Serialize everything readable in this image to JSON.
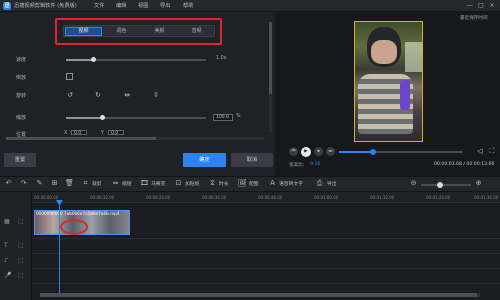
{
  "app": {
    "logo_glyph": "迅",
    "title": "迅捷视频剪辑软件 (免费版)",
    "menu": [
      "文件",
      "编辑",
      "视图",
      "导出",
      "帮助"
    ],
    "window_controls": [
      "—",
      "□",
      "×"
    ]
  },
  "editor": {
    "tabs": [
      {
        "label": "视频",
        "active": true
      },
      {
        "label": "调色",
        "active": false
      },
      {
        "label": "美颜",
        "active": false
      },
      {
        "label": "音频",
        "active": false
      }
    ],
    "speed": {
      "label": "速度",
      "value": "1.0x",
      "level": 0.1
    },
    "reverse": {
      "label": "倒放",
      "checked": false
    },
    "rotate": {
      "label": "旋转",
      "icons": [
        "rotate-ccw-icon",
        "rotate-cw-icon",
        "flip-horizontal-icon",
        "flip-vertical-icon"
      ],
      "glyphs": [
        "↺",
        "↻",
        "⇹",
        "⇳"
      ]
    },
    "scale": {
      "label": "缩放",
      "value": "100.0",
      "unit": "%",
      "level": 0.25
    },
    "position": {
      "label": "位置",
      "x_label": "X",
      "x_value": "0.0",
      "y_label": "Y",
      "y_value": "0.0"
    },
    "buttons": {
      "reset": "重置",
      "ok": "确定",
      "cancel": "取消"
    }
  },
  "preview": {
    "label": "最近保存时间",
    "controls": [
      "⏮",
      "▶",
      "⏹",
      "⏭"
    ],
    "progress": 0.26,
    "ratio_label": "宽高比:",
    "ratio_value": "9:16",
    "timecode": "00:00:03.68 / 00:00:13.66",
    "right_icons": [
      "◁",
      "⛶"
    ]
  },
  "toolbar": {
    "icons": [
      "↶",
      "↷",
      "✎",
      "⊞",
      "🗑"
    ],
    "items": [
      {
        "icon": "⌗",
        "label": "裁剪"
      },
      {
        "icon": "⇔",
        "label": "缩短"
      },
      {
        "icon": "🎞",
        "label": "马赛克"
      },
      {
        "icon": "⊡",
        "label": "加贴纸"
      },
      {
        "icon": "⧖",
        "label": "时长"
      },
      {
        "icon": "🖼",
        "label": "配图"
      },
      {
        "icon": "A",
        "label": "语音转文字"
      }
    ],
    "export": {
      "icon": "⎙",
      "label": "导出"
    },
    "zoom_icons": [
      "⊖",
      "⊕"
    ],
    "zoom_level": 0.32
  },
  "timeline": {
    "ticks": [
      "00:00:00.00",
      "00:00:12.00",
      "00:00:24.00",
      "00:00:36.00",
      "00:00:48.00",
      "00:01:00.00",
      "00:01:12.00",
      "00:01:24.00",
      "00:01:36.00"
    ],
    "clip_title": "0000000000 7ab0b6e7a1b6e7a6b.mp4",
    "track_icons": [
      "▦",
      "T",
      "♪",
      "🎤",
      "⬚"
    ]
  }
}
